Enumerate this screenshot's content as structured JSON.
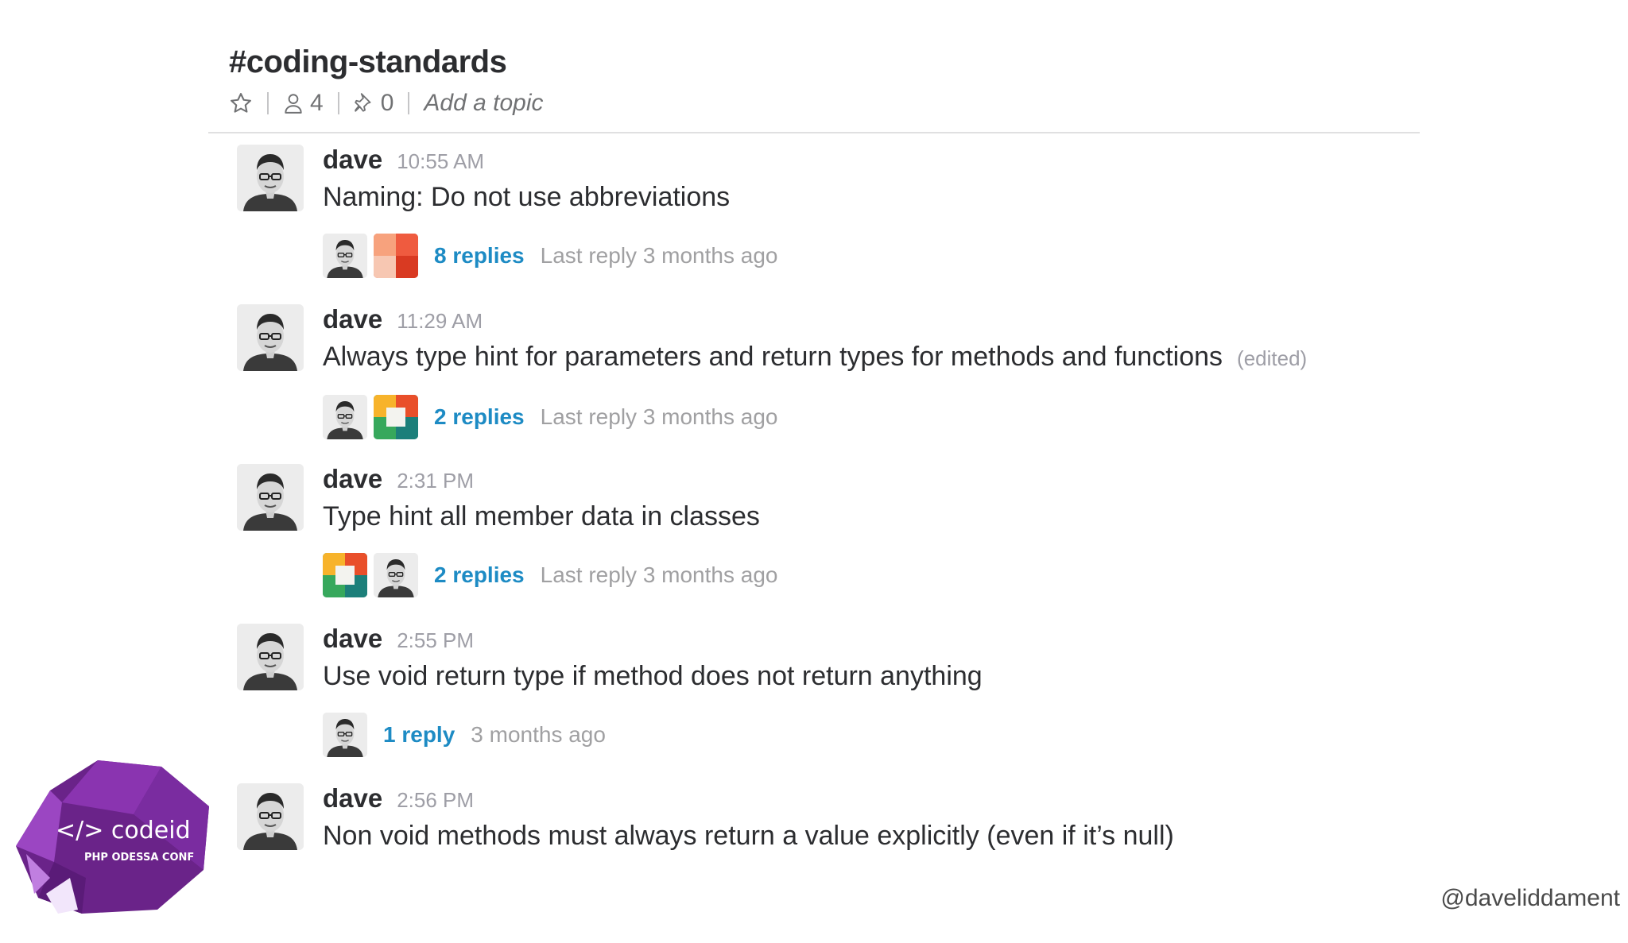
{
  "channel": {
    "title": "#coding-standards",
    "member_count": "4",
    "pinned_count": "0",
    "topic_placeholder": "Add a topic"
  },
  "messages": [
    {
      "author": "dave",
      "time": "10:55 AM",
      "text": "Naming: Do not use abbreviations",
      "edited": "",
      "thread": {
        "replies": "8 replies",
        "last_reply": "Last reply 3 months ago",
        "participants": [
          "dave-photo",
          "red-orange-tiles"
        ]
      }
    },
    {
      "author": "dave",
      "time": "11:29 AM",
      "text": "Always type hint for parameters and return types for methods and functions",
      "edited": "(edited)",
      "thread": {
        "replies": "2 replies",
        "last_reply": "Last reply 3 months ago",
        "participants": [
          "dave-photo",
          "multicolor-tiles"
        ]
      }
    },
    {
      "author": "dave",
      "time": "2:31 PM",
      "text": "Type hint all member data in classes",
      "edited": "",
      "thread": {
        "replies": "2 replies",
        "last_reply": "Last reply 3 months ago",
        "participants": [
          "multicolor-tiles",
          "dave-photo"
        ]
      }
    },
    {
      "author": "dave",
      "time": "2:55 PM",
      "text": "Use void return type if method does not return anything",
      "edited": "",
      "thread": {
        "replies": "1 reply",
        "last_reply": "3 months ago",
        "participants": [
          "dave-photo"
        ]
      }
    },
    {
      "author": "dave",
      "time": "2:56 PM",
      "text": "Non void methods must always return a value explicitly (even if it’s null)",
      "edited": "",
      "thread": null
    }
  ],
  "logo": {
    "brand": "</> codeid",
    "subtitle": "PHP ODESSA CONF"
  },
  "handle": "@daveliddament",
  "colors": {
    "link": "#1d8bc4",
    "muted": "#9e9ea6",
    "text": "#2c2d30",
    "logo_purple": "#7b2d9e"
  }
}
